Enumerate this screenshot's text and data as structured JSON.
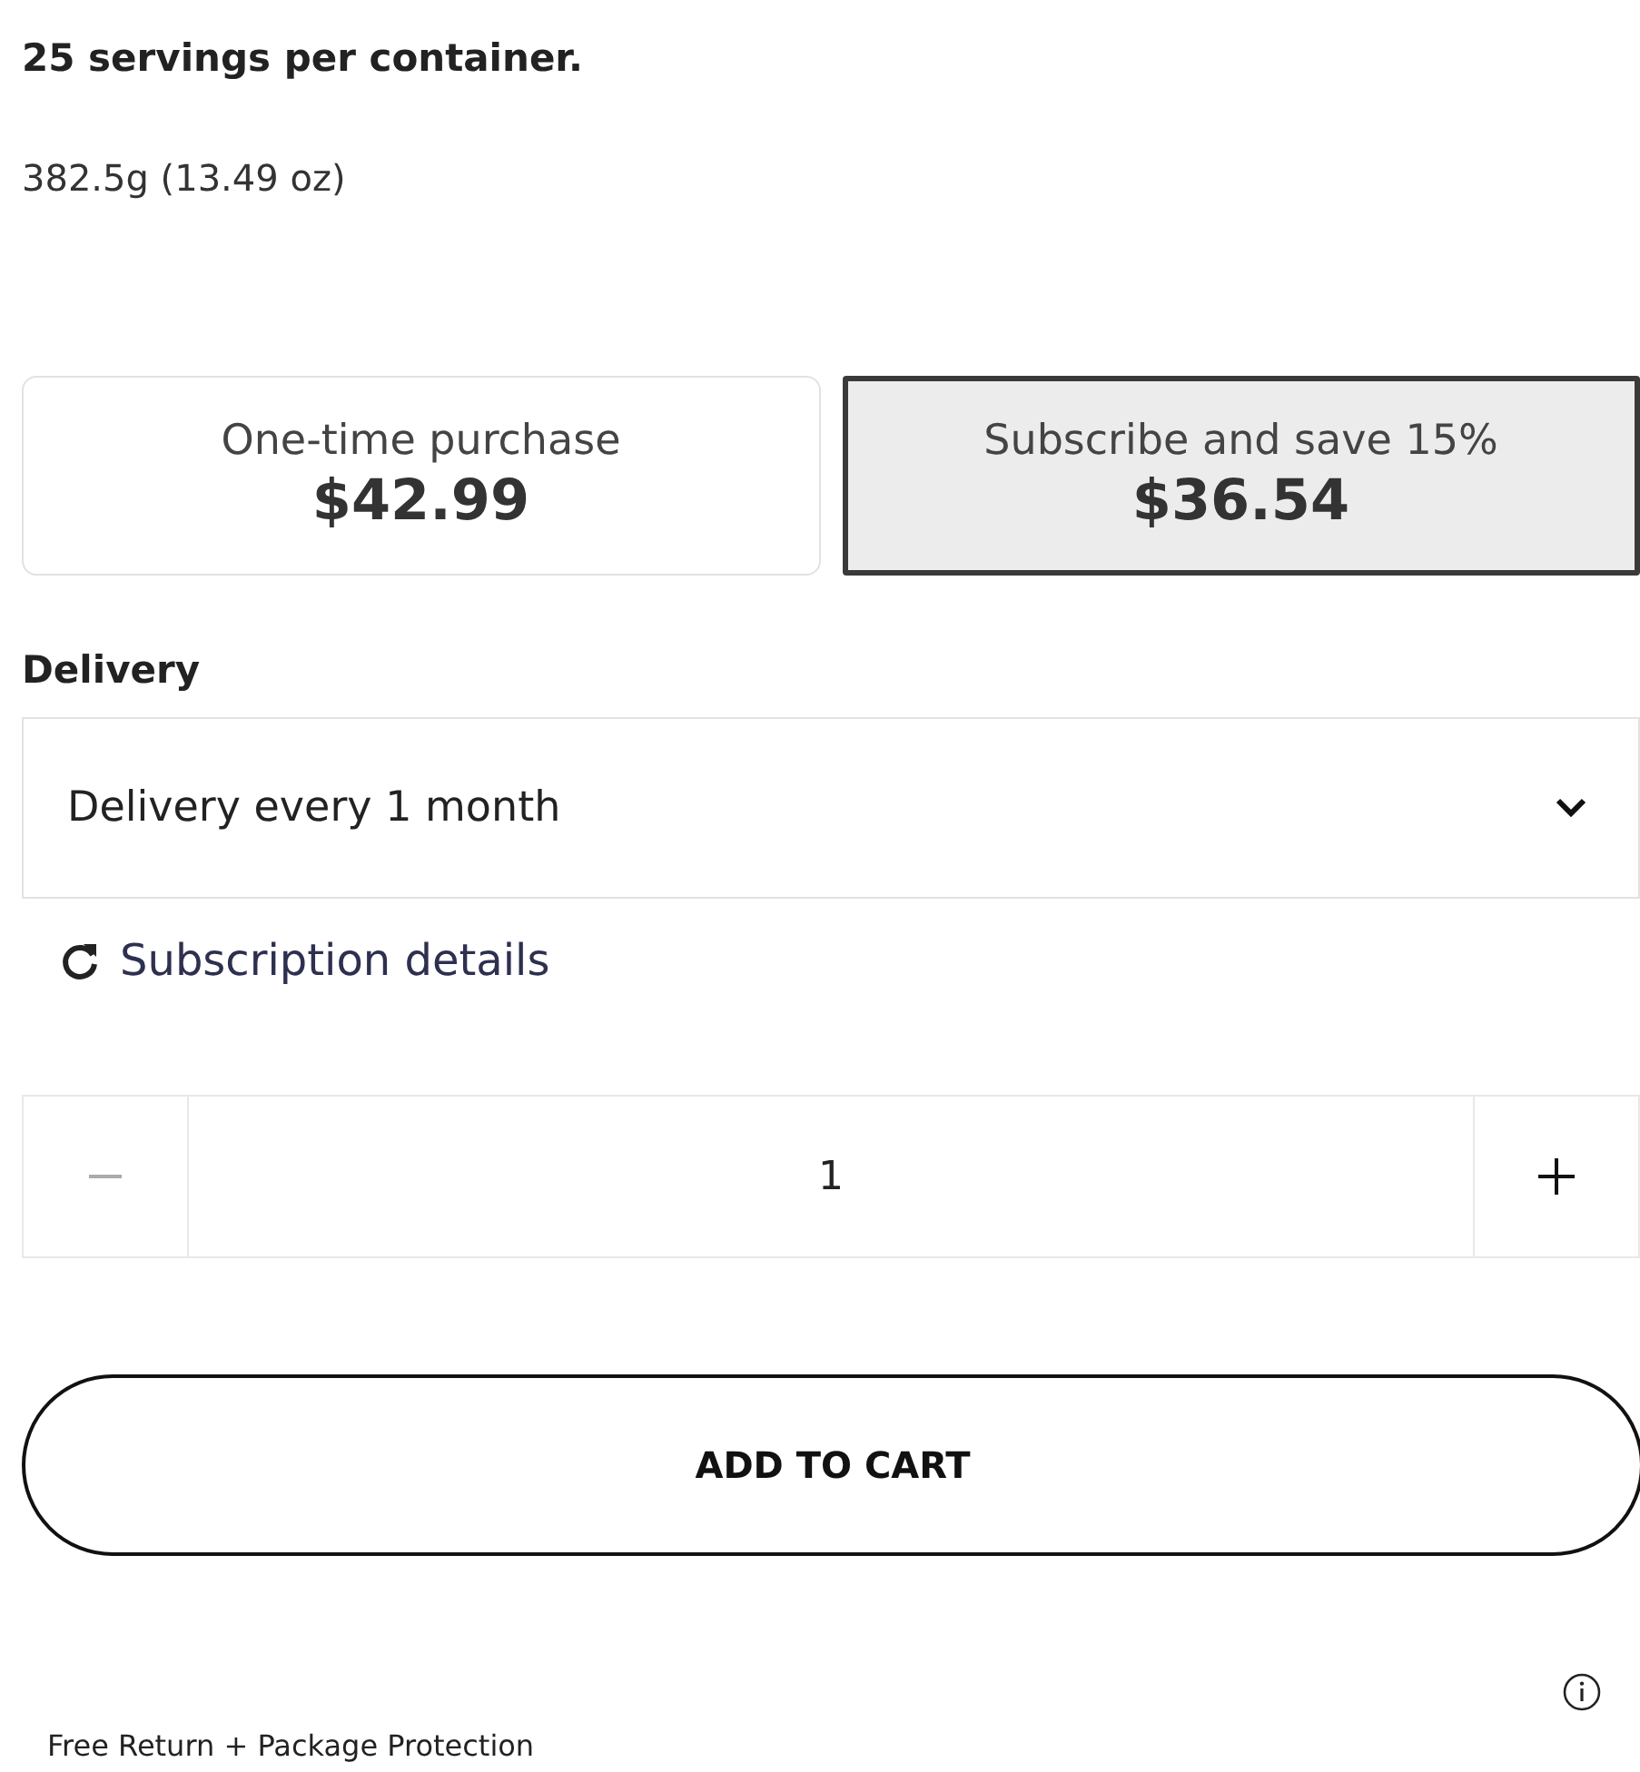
{
  "product": {
    "servings": "25 servings per container.",
    "weight": "382.5g (13.49 oz)"
  },
  "purchase_options": [
    {
      "label": "One-time purchase",
      "price": "$42.99",
      "selected": false
    },
    {
      "label": "Subscribe and save 15%",
      "price": "$36.54",
      "selected": true
    }
  ],
  "delivery": {
    "label": "Delivery",
    "value": "Delivery every 1 month"
  },
  "subscription_link": "Subscription details",
  "quantity": {
    "value": "1",
    "decrement_disabled": true
  },
  "add_to_cart": "ADD TO CART",
  "footer": {
    "text": "Free Return + Package Protection"
  }
}
